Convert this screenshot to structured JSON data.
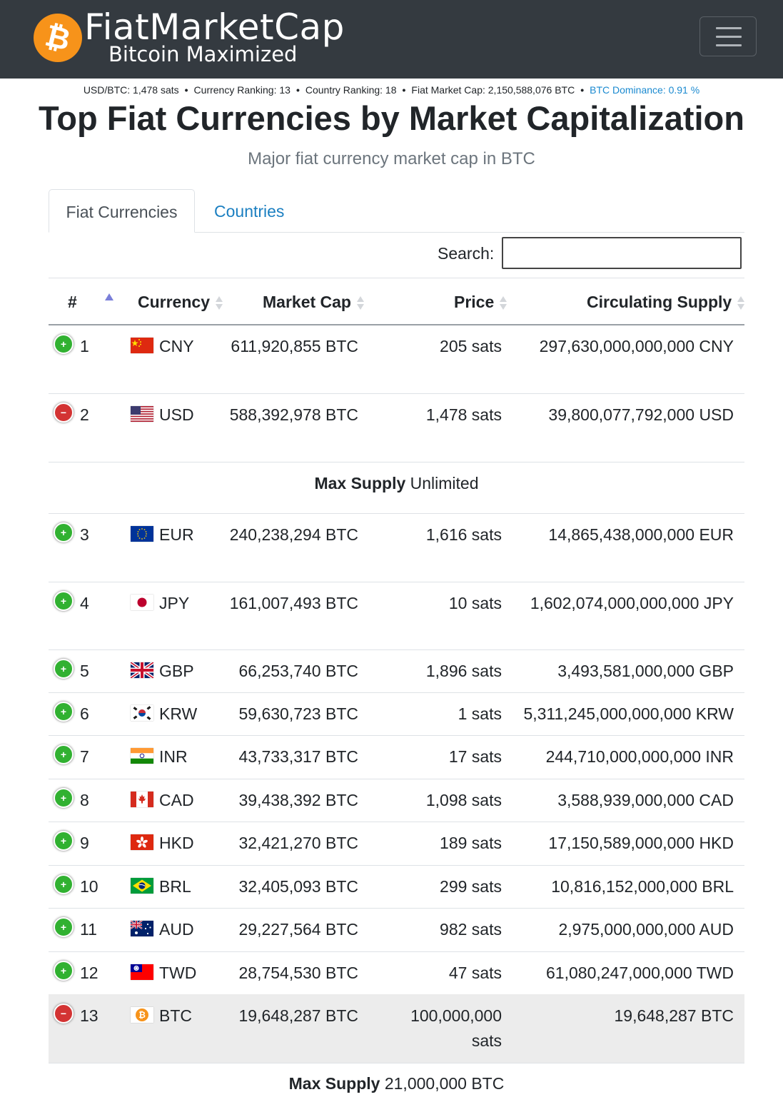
{
  "header": {
    "logo_glyph": "₿",
    "brand": "FiatMarketCap",
    "tagline": "Bitcoin Maximized"
  },
  "stats": {
    "usd_btc": "USD/BTC: 1,478 sats",
    "currency_ranking": "Currency Ranking: 13",
    "country_ranking": "Country Ranking: 18",
    "fiat_market_cap": "Fiat Market Cap: 2,150,588,076 BTC",
    "btc_dominance": "BTC Dominance: 0.91 %",
    "separator": "•"
  },
  "page": {
    "title": "Top Fiat Currencies by Market Capitalization",
    "subtitle": "Major fiat currency market cap in BTC"
  },
  "tabs": {
    "active": "Fiat Currencies",
    "other": "Countries"
  },
  "search": {
    "label": "Search:",
    "value": ""
  },
  "table": {
    "headers": {
      "rank": "#",
      "currency": "Currency",
      "market_cap": "Market Cap",
      "price": "Price",
      "supply": "Circulating Supply"
    },
    "rows": [
      {
        "rank": "1",
        "code": "CNY",
        "market_cap": "611,920,855 BTC",
        "price": "205 sats",
        "supply": "297,630,000,000,000 CNY",
        "control": "+"
      },
      {
        "rank": "2",
        "code": "USD",
        "market_cap": "588,392,978 BTC",
        "price": "1,478 sats",
        "supply": "39,800,077,792,000 USD",
        "control": "−"
      },
      {
        "rank": "3",
        "code": "EUR",
        "market_cap": "240,238,294 BTC",
        "price": "1,616 sats",
        "supply": "14,865,438,000,000 EUR",
        "control": "+"
      },
      {
        "rank": "4",
        "code": "JPY",
        "market_cap": "161,007,493 BTC",
        "price": "10 sats",
        "supply": "1,602,074,000,000,000 JPY",
        "control": "+"
      },
      {
        "rank": "5",
        "code": "GBP",
        "market_cap": "66,253,740 BTC",
        "price": "1,896 sats",
        "supply": "3,493,581,000,000 GBP",
        "control": "+"
      },
      {
        "rank": "6",
        "code": "KRW",
        "market_cap": "59,630,723 BTC",
        "price": "1 sats",
        "supply": "5,311,245,000,000,000 KRW",
        "control": "+"
      },
      {
        "rank": "7",
        "code": "INR",
        "market_cap": "43,733,317 BTC",
        "price": "17 sats",
        "supply": "244,710,000,000,000 INR",
        "control": "+"
      },
      {
        "rank": "8",
        "code": "CAD",
        "market_cap": "39,438,392 BTC",
        "price": "1,098 sats",
        "supply": "3,588,939,000,000 CAD",
        "control": "+"
      },
      {
        "rank": "9",
        "code": "HKD",
        "market_cap": "32,421,270 BTC",
        "price": "189 sats",
        "supply": "17,150,589,000,000 HKD",
        "control": "+"
      },
      {
        "rank": "10",
        "code": "BRL",
        "market_cap": "32,405,093 BTC",
        "price": "299 sats",
        "supply": "10,816,152,000,000 BRL",
        "control": "+"
      },
      {
        "rank": "11",
        "code": "AUD",
        "market_cap": "29,227,564 BTC",
        "price": "982 sats",
        "supply": "2,975,000,000,000 AUD",
        "control": "+"
      },
      {
        "rank": "12",
        "code": "TWD",
        "market_cap": "28,754,530 BTC",
        "price": "47 sats",
        "supply": "61,080,247,000,000 TWD",
        "control": "+"
      },
      {
        "rank": "13",
        "code": "BTC",
        "market_cap": "19,648,287 BTC",
        "price": "100,000,000 sats",
        "supply": "19,648,287 BTC",
        "control": "−"
      }
    ],
    "usd_child": {
      "label": "Max Supply",
      "value": "Unlimited"
    },
    "btc_child": {
      "label": "Max Supply",
      "value": "21,000,000 BTC"
    }
  },
  "colors": {
    "navbar": "#343a40",
    "bitcoin_orange": "#f7931a",
    "link_blue": "#1b7fc1",
    "expand_green": "#31b131",
    "collapse_red": "#d33333"
  }
}
